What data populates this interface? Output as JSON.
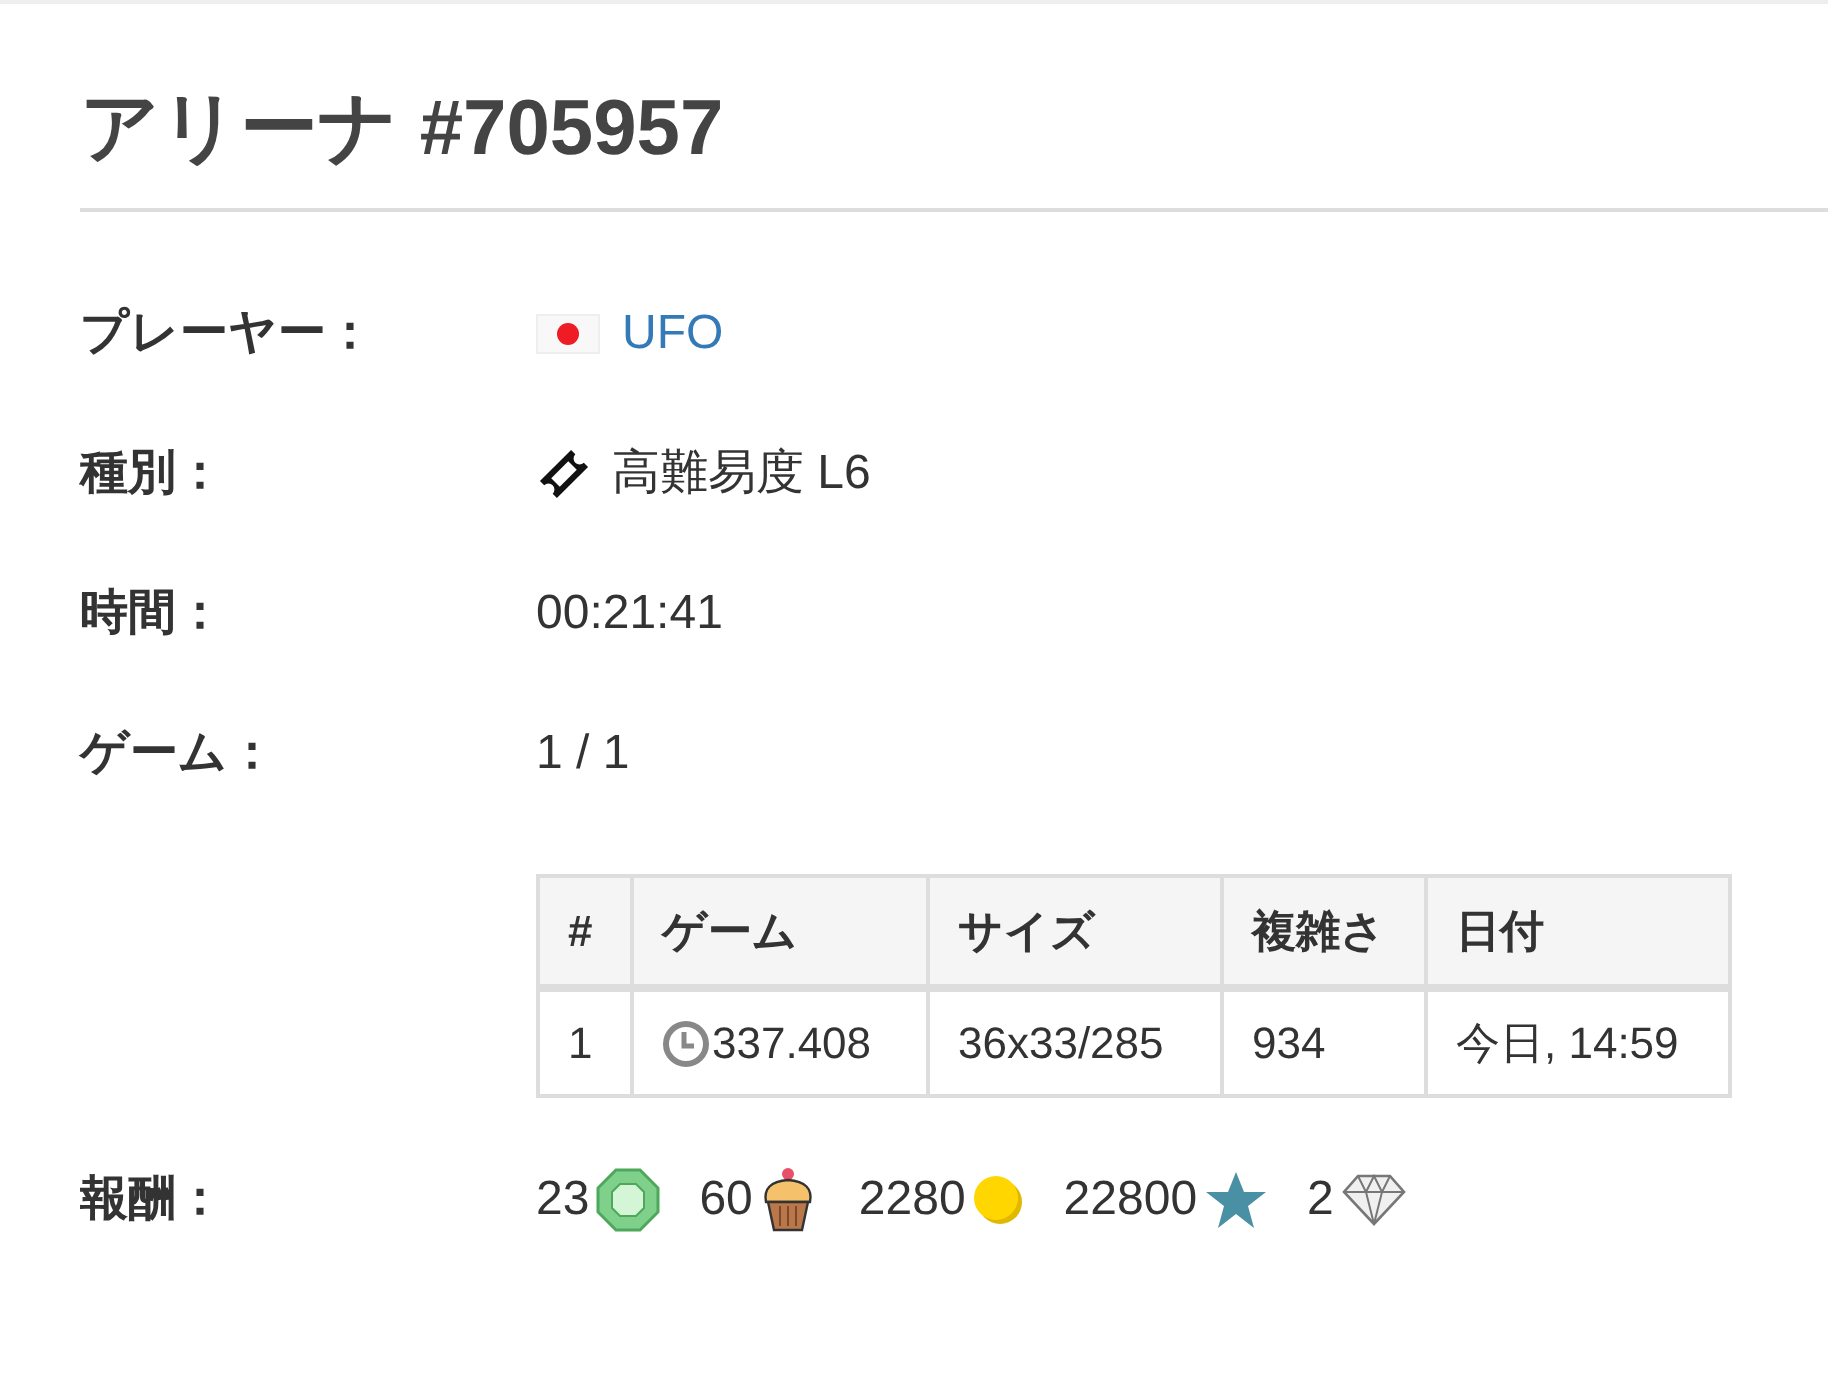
{
  "page": {
    "title": "アリーナ #705957"
  },
  "details": [
    {
      "kind": "player",
      "label": "プレーヤー：",
      "value": "UFO"
    },
    {
      "kind": "mode",
      "label": "種別：",
      "value": "高難易度 L6"
    },
    {
      "kind": "text",
      "label": "時間：",
      "value": "00:21:41"
    },
    {
      "kind": "text",
      "label": "ゲーム：",
      "value": "1 / 1"
    }
  ],
  "games_table": {
    "columns": [
      "#",
      "ゲーム",
      "サイズ",
      "複雑さ",
      "日付"
    ],
    "rows": [
      {
        "cells": [
          {
            "kind": "text",
            "text": "1"
          },
          {
            "kind": "time",
            "text": "337.408"
          },
          {
            "kind": "text",
            "text": "36x33/285"
          },
          {
            "kind": "text",
            "text": "934"
          },
          {
            "kind": "text",
            "text": "今日, 14:59"
          }
        ]
      }
    ]
  },
  "rewards": {
    "label": "報酬：",
    "items": [
      {
        "kind": "gem",
        "amount": "23"
      },
      {
        "kind": "cupcake",
        "amount": "60"
      },
      {
        "kind": "coin",
        "amount": "2280"
      },
      {
        "kind": "star",
        "amount": "22800"
      },
      {
        "kind": "diamond",
        "amount": "2"
      }
    ]
  }
}
